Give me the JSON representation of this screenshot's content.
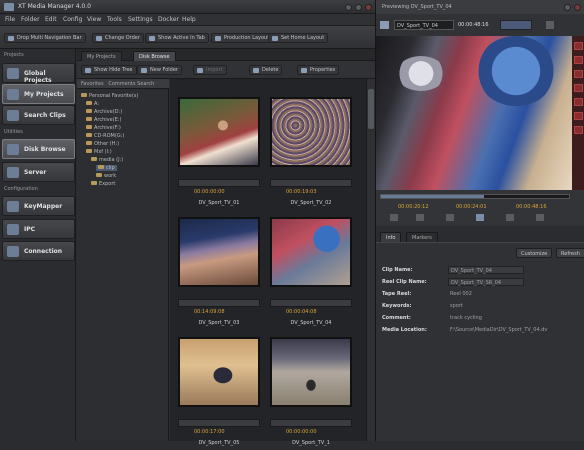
{
  "window": {
    "title": "XT Media Manager 4.0.0"
  },
  "menu": [
    "File",
    "Folder",
    "Edit",
    "Config",
    "View",
    "Tools",
    "Settings",
    "Docker",
    "Help"
  ],
  "toolbar": {
    "items": [
      "Drop Multi Navigation Bar",
      "Change Order",
      "Show Active In Tab",
      "Production Layout",
      "Set Home Layout"
    ]
  },
  "nav": {
    "sections": [
      "Projects",
      "Utilities",
      "Configuration"
    ],
    "items": [
      "Global Projects",
      "My Projects",
      "Search Clips",
      "Disk Browse",
      "Server",
      "KeyMapper",
      "IPC",
      "Connection"
    ]
  },
  "tabs": [
    "My Projects",
    "Disk Browse"
  ],
  "subtool": [
    "Show Hide Tree",
    "New Folder",
    "Import",
    "Delete",
    "Properties"
  ],
  "tree": {
    "header": [
      "Favorites",
      "Comments Search"
    ],
    "nodes": [
      "Personal Favorite(s)",
      "A:",
      "Archive(D:)",
      "Archive(E:)",
      "Archive(F:)",
      "CD-ROM(G:)",
      "Other (H:)",
      "Mxf (I:)",
      "media (J:)",
      "clip",
      "work",
      "Export"
    ]
  },
  "clips": [
    {
      "name": "DV_Sport_TV_01",
      "tc": "00:00:00:00"
    },
    {
      "name": "DV_Sport_TV_02",
      "tc": "00:00:19:03"
    },
    {
      "name": "DV_Sport_TV_03",
      "tc": "00:14:09:08"
    },
    {
      "name": "DV_Sport_TV_04",
      "tc": "00:00:04:08"
    },
    {
      "name": "DV_Sport_TV_05",
      "tc": "00:00:17:00"
    },
    {
      "name": "DV_Sport_TV_1",
      "tc": "00:00:00:00"
    }
  ],
  "player": {
    "title": "Previewing DV_Sport_TV_04",
    "clip_select": "DV_Sport_TV_04",
    "timecode": "00:00:48:16",
    "tc_in": "00:00:20:12",
    "tc_out": "00:00:24:01",
    "tc_dur": "00:00:48:16"
  },
  "props": {
    "tabs": [
      "Info",
      "Markers"
    ],
    "buttons": [
      "Customize",
      "Refresh"
    ],
    "fields": [
      {
        "label": "Clip Name:",
        "value": "DV_Sport_TV_04"
      },
      {
        "label": "Reel Clip Name:",
        "value": "DV_Sport_TV_SR_04"
      },
      {
        "label": "Tape Reel:",
        "value": "Reel 002"
      },
      {
        "label": "Keywords:",
        "value": "sport"
      },
      {
        "label": "Comment:",
        "value": "track cycling"
      },
      {
        "label": "Media Location:",
        "value": "F:\\Source\\MediaDir\\DV_Sport_TV_04.dv"
      }
    ]
  },
  "colors": {
    "accent": "#d9a43a",
    "panel": "#2f3134",
    "alert": "#8a2c2c"
  }
}
